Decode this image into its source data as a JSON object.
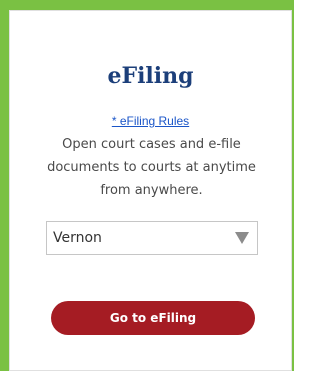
{
  "card": {
    "title": "eFiling",
    "rules_link": "* eFiling Rules",
    "description": "Open court cases and e-file documents to courts at anytime from anywhere."
  },
  "county_select": {
    "selected": "Vernon",
    "icon": "dropdown-arrow-icon"
  },
  "go_button": {
    "label": "Go to eFiling"
  },
  "colors": {
    "border_green": "#7ac143",
    "title_blue": "#1c3f7a",
    "link_blue": "#1a55c8",
    "button_red": "#a51c23"
  }
}
